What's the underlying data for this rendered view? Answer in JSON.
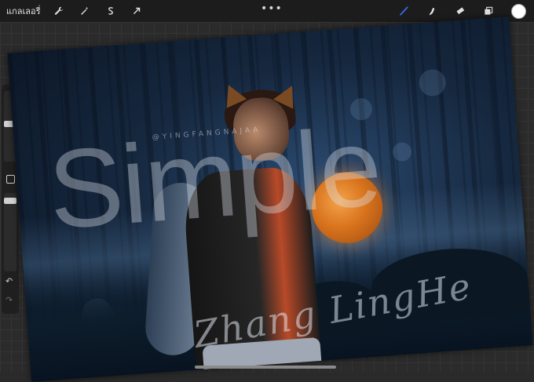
{
  "toolbar": {
    "gallery_label": "แกลเลอรี่",
    "left_icons": [
      "wrench-icon",
      "magic-wand-icon",
      "selection-s-icon",
      "transform-arrow-icon"
    ],
    "more_label": "•••",
    "right_icons": [
      "brush-icon",
      "smudge-icon",
      "eraser-icon",
      "layers-icon"
    ],
    "brush_color": "#2f6fe0",
    "current_color": "#ffffff"
  },
  "sidebar": {
    "undo_label": "↶",
    "redo_label": "↷"
  },
  "artwork": {
    "watermark_text": "Simple",
    "handle_text": "@YINGFANGNAJAA",
    "signature_text": "Zhang LingHe",
    "moon_color": "#e0822a"
  }
}
